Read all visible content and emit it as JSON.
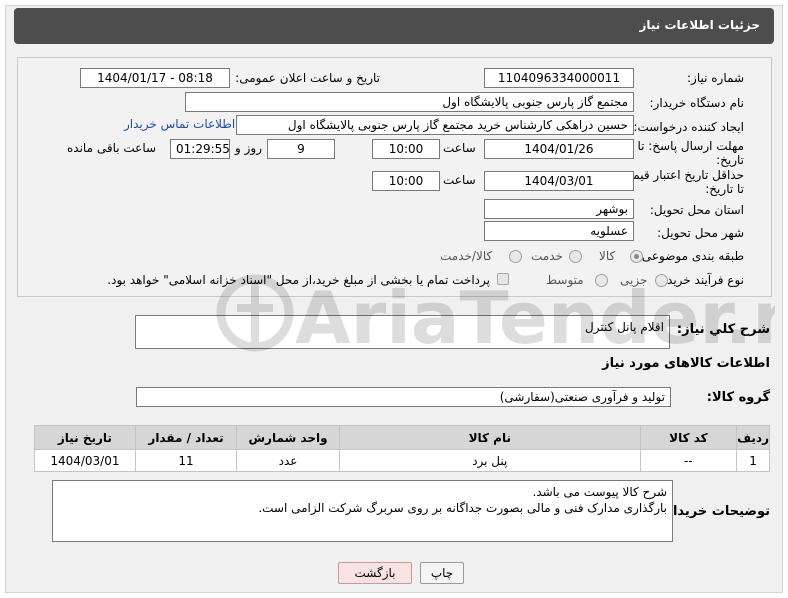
{
  "header": {
    "title": "جزئیات اطلاعات نیاز"
  },
  "form": {
    "need_number_label": "شماره نیاز:",
    "need_number": "1104096334000011",
    "announce_label": "تاریخ و ساعت اعلان عمومی:",
    "announce_value": "1404/01/17 - 08:18",
    "buyer_label": "نام دستگاه خریدار:",
    "buyer_value": "مجتمع گاز پارس جنوبی  پالایشگاه اول",
    "creator_label": "ایجاد کننده درخواست:",
    "creator_value": "حسین دراهکی کارشناس خرید مجتمع گاز پارس جنوبی  پالایشگاه اول",
    "contact_link": "اطلاعات تماس خریدار",
    "deadline_label_1": "مهلت ارسال پاسخ: تا",
    "deadline_label_2": "تاریخ:",
    "deadline_date": "1404/01/26",
    "time_label": "ساعت",
    "deadline_time": "10:00",
    "days_value": "9",
    "days_label": "روز و",
    "remaining_value": "01:29:55",
    "remaining_label": "ساعت باقی مانده",
    "validity_label_1": "حداقل تاریخ اعتبار قیمت:",
    "validity_label_2": "تا تاریخ:",
    "validity_date": "1404/03/01",
    "validity_time": "10:00",
    "province_label": "استان محل تحویل:",
    "province_value": "بوشهر",
    "city_label": "شهر محل تحویل:",
    "city_value": "عسلویه",
    "category_label": "طبقه بندی موضوعی:",
    "category_options": [
      "کالا",
      "خدمت",
      "کالا/خدمت"
    ],
    "category_selected": "کالا",
    "process_label": "نوع فرآیند خرید :",
    "process_options": [
      "جزیی",
      "متوسط"
    ],
    "payment_note": "پرداخت تمام یا بخشی از مبلغ خرید،از محل \"اسناد خزانه اسلامی\" خواهد بود."
  },
  "description": {
    "label": "شرح کلي نياز:",
    "value": "اقلام پانل کنترل"
  },
  "goods_section": {
    "title": "اطلاعات کالاهای مورد نیاز",
    "group_label": "گروه کالا:",
    "group_value": "تولید و فرآوری صنعتی(سفارشی)"
  },
  "table": {
    "headers": [
      "ردیف",
      "کد کالا",
      "نام کالا",
      "واحد شمارش",
      "تعداد / مقدار",
      "تاریخ نیاز"
    ],
    "rows": [
      [
        "1",
        "--",
        "پنل برد",
        "عدد",
        "11",
        "1404/03/01"
      ]
    ]
  },
  "buyer_notes": {
    "label": "توضیحات خریدار:",
    "line1": "شرح کالا پیوست می باشد.",
    "line2": "بارگذاری مدارک فنی و مالی بصورت جداگانه بر روی سربرگ شرکت الزامی است."
  },
  "buttons": {
    "print": "چاپ",
    "back": "بازگشت"
  },
  "watermark": {
    "text": "AriaTender.neT"
  },
  "colors": {
    "header_bg": "#4d4d4d",
    "link": "#1a4fb0",
    "back_button": "#fbe2e2"
  }
}
